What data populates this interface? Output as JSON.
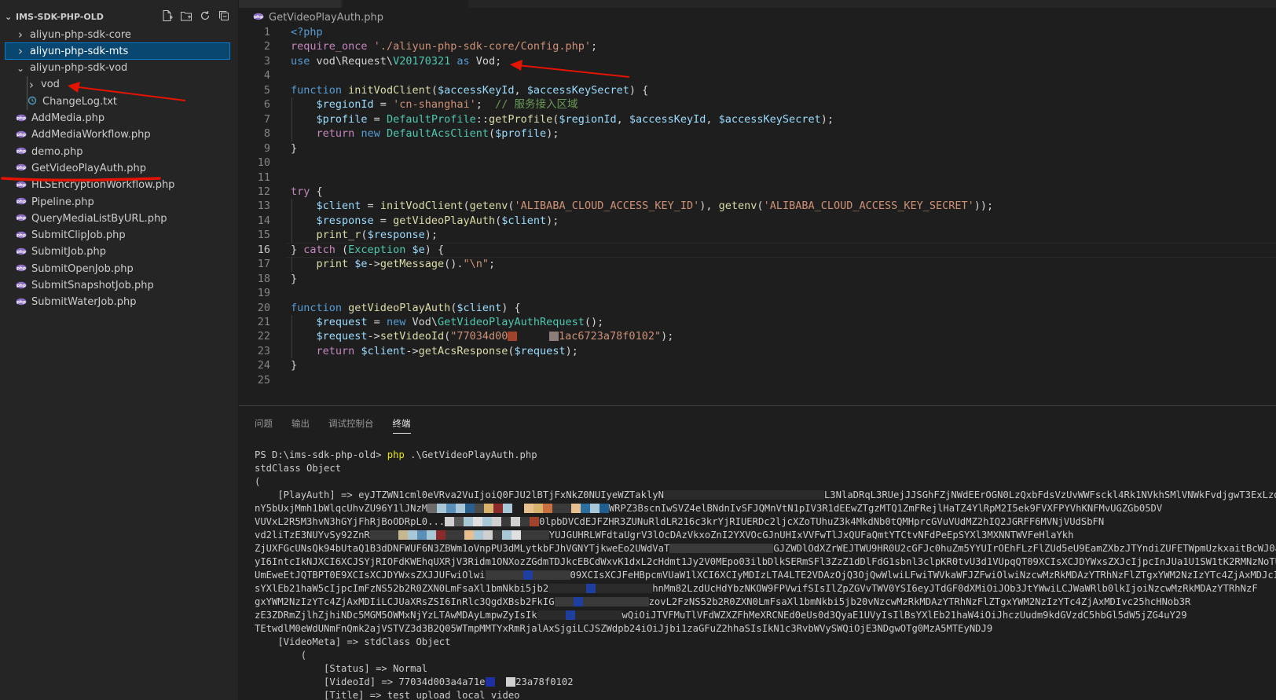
{
  "sidebar": {
    "title": "IMS-SDK-PHP-OLD",
    "actions": [
      "new-file-icon",
      "new-folder-icon",
      "refresh-icon",
      "collapse-icon"
    ],
    "items": [
      {
        "label": "aliyun-php-sdk-core",
        "kind": "folder",
        "expanded": false,
        "level": 1
      },
      {
        "label": "aliyun-php-sdk-mts",
        "kind": "folder",
        "expanded": false,
        "level": 1,
        "selected": true
      },
      {
        "label": "aliyun-php-sdk-vod",
        "kind": "folder",
        "expanded": true,
        "level": 1
      },
      {
        "label": "vod",
        "kind": "folder",
        "expanded": false,
        "level": 2
      },
      {
        "label": "ChangeLog.txt",
        "kind": "txt",
        "level": 2
      },
      {
        "label": "AddMedia.php",
        "kind": "php",
        "level": 1
      },
      {
        "label": "AddMediaWorkflow.php",
        "kind": "php",
        "level": 1
      },
      {
        "label": "demo.php",
        "kind": "php",
        "level": 1
      },
      {
        "label": "GetVideoPlayAuth.php",
        "kind": "php",
        "level": 1
      },
      {
        "label": "HLSEncryptionWorkflow.php",
        "kind": "php",
        "level": 1
      },
      {
        "label": "Pipeline.php",
        "kind": "php",
        "level": 1
      },
      {
        "label": "QueryMediaListByURL.php",
        "kind": "php",
        "level": 1
      },
      {
        "label": "SubmitClipJob.php",
        "kind": "php",
        "level": 1
      },
      {
        "label": "SubmitJob.php",
        "kind": "php",
        "level": 1
      },
      {
        "label": "SubmitOpenJob.php",
        "kind": "php",
        "level": 1
      },
      {
        "label": "SubmitSnapshotJob.php",
        "kind": "php",
        "level": 1
      },
      {
        "label": "SubmitWaterJob.php",
        "kind": "php",
        "level": 1
      }
    ]
  },
  "editor": {
    "breadcrumb": "GetVideoPlayAuth.php",
    "current_line": 16,
    "lines": [
      [
        [
          "k",
          "<?php"
        ]
      ],
      [
        [
          "c",
          "require_once"
        ],
        [
          "p",
          " "
        ],
        [
          "s",
          "'./aliyun-php-sdk-core/Config.php'"
        ],
        [
          "p",
          ";"
        ]
      ],
      [
        [
          "k",
          "use"
        ],
        [
          "p",
          " vod\\Request\\"
        ],
        [
          "t",
          "V20170321"
        ],
        [
          "p",
          " "
        ],
        [
          "k",
          "as"
        ],
        [
          "p",
          " Vod;"
        ]
      ],
      [],
      [
        [
          "k",
          "function"
        ],
        [
          "p",
          " "
        ],
        [
          "f",
          "initVodClient"
        ],
        [
          "p",
          "("
        ],
        [
          "v",
          "$accessKeyId"
        ],
        [
          "p",
          ", "
        ],
        [
          "v",
          "$accessKeySecret"
        ],
        [
          "p",
          ") {"
        ]
      ],
      [
        [
          "p",
          "    "
        ],
        [
          "v",
          "$regionId"
        ],
        [
          "p",
          " = "
        ],
        [
          "s",
          "'cn-shanghai'"
        ],
        [
          "p",
          ";  "
        ],
        [
          "cm",
          "// 服务接入区域"
        ]
      ],
      [
        [
          "p",
          "    "
        ],
        [
          "v",
          "$profile"
        ],
        [
          "p",
          " = "
        ],
        [
          "t",
          "DefaultProfile"
        ],
        [
          "p",
          "::"
        ],
        [
          "f",
          "getProfile"
        ],
        [
          "p",
          "("
        ],
        [
          "v",
          "$regionId"
        ],
        [
          "p",
          ", "
        ],
        [
          "v",
          "$accessKeyId"
        ],
        [
          "p",
          ", "
        ],
        [
          "v",
          "$accessKeySecret"
        ],
        [
          "p",
          ");"
        ]
      ],
      [
        [
          "p",
          "    "
        ],
        [
          "c",
          "return"
        ],
        [
          "p",
          " "
        ],
        [
          "k",
          "new"
        ],
        [
          "p",
          " "
        ],
        [
          "t",
          "DefaultAcsClient"
        ],
        [
          "p",
          "("
        ],
        [
          "v",
          "$profile"
        ],
        [
          "p",
          ");"
        ]
      ],
      [
        [
          "p",
          "}"
        ]
      ],
      [],
      [],
      [
        [
          "c",
          "try"
        ],
        [
          "p",
          " {"
        ]
      ],
      [
        [
          "p",
          "    "
        ],
        [
          "v",
          "$client"
        ],
        [
          "p",
          " = "
        ],
        [
          "f",
          "initVodClient"
        ],
        [
          "p",
          "("
        ],
        [
          "f",
          "getenv"
        ],
        [
          "p",
          "("
        ],
        [
          "s",
          "'ALIBABA_CLOUD_ACCESS_KEY_ID'"
        ],
        [
          "p",
          "), "
        ],
        [
          "f",
          "getenv"
        ],
        [
          "p",
          "("
        ],
        [
          "s",
          "'ALIBABA_CLOUD_ACCESS_KEY_SECRET'"
        ],
        [
          "p",
          "));"
        ]
      ],
      [
        [
          "p",
          "    "
        ],
        [
          "v",
          "$response"
        ],
        [
          "p",
          " = "
        ],
        [
          "f",
          "getVideoPlayAuth"
        ],
        [
          "p",
          "("
        ],
        [
          "v",
          "$client"
        ],
        [
          "p",
          ");"
        ]
      ],
      [
        [
          "p",
          "    "
        ],
        [
          "f",
          "print_r"
        ],
        [
          "p",
          "("
        ],
        [
          "v",
          "$response"
        ],
        [
          "p",
          ");"
        ]
      ],
      [
        [
          "p",
          "} "
        ],
        [
          "c",
          "catch"
        ],
        [
          "p",
          " ("
        ],
        [
          "t",
          "Exception"
        ],
        [
          "p",
          " "
        ],
        [
          "v",
          "$e"
        ],
        [
          "p",
          ") {"
        ]
      ],
      [
        [
          "p",
          "    "
        ],
        [
          "f",
          "print"
        ],
        [
          "p",
          " "
        ],
        [
          "v",
          "$e"
        ],
        [
          "p",
          "->"
        ],
        [
          "f",
          "getMessage"
        ],
        [
          "p",
          "()."
        ],
        [
          "s",
          "\"\\n\""
        ],
        [
          "p",
          ";"
        ]
      ],
      [
        [
          "p",
          "}"
        ]
      ],
      [],
      [
        [
          "k",
          "function"
        ],
        [
          "p",
          " "
        ],
        [
          "f",
          "getVideoPlayAuth"
        ],
        [
          "p",
          "("
        ],
        [
          "v",
          "$client"
        ],
        [
          "p",
          ") {"
        ]
      ],
      [
        [
          "p",
          "    "
        ],
        [
          "v",
          "$request"
        ],
        [
          "p",
          " = "
        ],
        [
          "k",
          "new"
        ],
        [
          "p",
          " Vod\\"
        ],
        [
          "t",
          "GetVideoPlayAuthRequest"
        ],
        [
          "p",
          "();"
        ]
      ],
      [
        [
          "p",
          "    "
        ],
        [
          "v",
          "$request"
        ],
        [
          "p",
          "->"
        ],
        [
          "f",
          "setVideoId"
        ],
        [
          "p",
          "("
        ],
        [
          "s",
          "\"77034d00"
        ],
        [
          "r",
          "#a0432c"
        ],
        [
          "s",
          "     "
        ],
        [
          "r",
          "#8b7d78"
        ],
        [
          "s",
          "1ac6723a78f0102\""
        ],
        [
          "p",
          ");"
        ]
      ],
      [
        [
          "p",
          "    "
        ],
        [
          "c",
          "return"
        ],
        [
          "p",
          " "
        ],
        [
          "v",
          "$client"
        ],
        [
          "p",
          "->"
        ],
        [
          "f",
          "getAcsResponse"
        ],
        [
          "p",
          "("
        ],
        [
          "v",
          "$request"
        ],
        [
          "p",
          ");"
        ]
      ],
      [
        [
          "p",
          "}"
        ]
      ],
      []
    ]
  },
  "panel": {
    "tabs": [
      "问题",
      "输出",
      "调试控制台",
      "终端"
    ],
    "active_tab": "终端",
    "terminal": [
      [
        [
          "p",
          "PS D:\\ims-sdk-php-old> "
        ],
        [
          "y",
          "php"
        ],
        [
          "p",
          " .\\GetVideoPlayAuth.php"
        ]
      ],
      [
        [
          "p",
          "stdClass Object"
        ]
      ],
      [
        [
          "p",
          "("
        ]
      ],
      [
        [
          "p",
          "    [PlayAuth] => eyJTZWN1cml0eVRva2VuIjoiQ0FJU2lBTjFxNkZ0NUIyeWZTaklyN"
        ],
        [
          "r",
          "#2a2a2a"
        ],
        [
          "r",
          "#2a2a2a"
        ],
        [
          "r",
          "#2a2a2a"
        ],
        [
          "r",
          "#2a2a2a"
        ],
        [
          "r",
          "#2a2a2a"
        ],
        [
          "r",
          "#2a2a2a"
        ],
        [
          "r",
          "#2a2a2a"
        ],
        [
          "r",
          "#2a2a2a"
        ],
        [
          "r",
          "#2a2a2a"
        ],
        [
          "r",
          "#2a2a2a"
        ],
        [
          "r",
          "#2a2a2a"
        ],
        [
          "r",
          "#2a2a2a"
        ],
        [
          "r",
          "#2a2a2a"
        ],
        [
          "r",
          "#2a2a2a"
        ],
        [
          "r",
          "#2a2a2a"
        ],
        [
          "r",
          "#2a2a2a"
        ],
        [
          "r",
          "#2a2a2a"
        ],
        [
          "p",
          "L3NlaDRqL3RUejJJSGhFZjNWdEErOGN0LzQxbFdsVzUvWWFsckl4Rk1NVkhSMlVNWkFvdjgwT3ExLzdKb0hiOXpEWUF"
        ]
      ],
      [
        [
          "p",
          "nY5bUxjMmh1bWlqcUhvZU96Y1lJNzM"
        ],
        [
          "r",
          "#6b6b6b"
        ],
        [
          "r",
          "#a8c8d8"
        ],
        [
          "r",
          "#5a8fb8"
        ],
        [
          "r",
          "#a8c8d8"
        ],
        [
          "r",
          "#2a5f8f"
        ],
        [
          "r",
          "#4b4b4b"
        ],
        [
          "r",
          "#d9b26b"
        ],
        [
          "r",
          "#8b2a2a"
        ],
        [
          "r",
          "#a8c8d8"
        ],
        [
          "p",
          "  "
        ],
        [
          "r",
          "#e8c090"
        ],
        [
          "r",
          "#d9b26b"
        ],
        [
          "r",
          "#c87040"
        ],
        [
          "r",
          "#3a3a3a"
        ],
        [
          "r",
          "#3a3a3a"
        ],
        [
          "r",
          "#e8c090"
        ],
        [
          "r",
          "#2a6f9f"
        ],
        [
          "r",
          "#a8c8d8"
        ],
        [
          "r",
          "#1f5f8f"
        ],
        [
          "p",
          "WRPZ3BscnIwSVZ4elBNdnIvSFJQMnVtN1pIV3R1dEEwZTgzMTQ1ZmFRejlHaTZ4YlRpM2I5ek9FVXFPYVhKNFMvUGZGb05DV"
        ]
      ],
      [
        [
          "p",
          "VUVxL2R5M3hvN3hGYjFhRjBoODRpL0..."
        ],
        [
          "r",
          "#d0d0d0"
        ],
        [
          "r",
          "#5a5a5a"
        ],
        [
          "r",
          "#a8c8d8"
        ],
        [
          "r",
          "#e0e0e0"
        ],
        [
          "r",
          "#a8c8d8"
        ],
        [
          "r",
          "#d0d0d0"
        ],
        [
          "r",
          "#3a3a3a"
        ],
        [
          "r",
          "#d0d0d0"
        ],
        [
          "r",
          "#3a3a3a"
        ],
        [
          "r",
          "#a0432c"
        ],
        [
          "p",
          "0lpbDVCdEJFZHR3ZUNuRldLR216c3krYjRIUERDc2ljcXZoTUhuZ3k4MkdNb0tQMHprcGVuVUdMZ2hIQ2JGRFF6MVNjVUdSbFN"
        ]
      ],
      [
        [
          "p",
          "vd2liTzE3NUYvSy92ZnR"
        ],
        [
          "r",
          "#3a3a3a"
        ],
        [
          "r",
          "#3a3a3a"
        ],
        [
          "r",
          "#3a3a3a"
        ],
        [
          "r",
          "#c8b890"
        ],
        [
          "r",
          "#a8c8d8"
        ],
        [
          "r",
          "#5a8fb8"
        ],
        [
          "r",
          "#a8c8d8"
        ],
        [
          "r",
          "#8b2a2a"
        ],
        [
          "r",
          "#3a3a3a"
        ],
        [
          "r",
          "#3a3a3a"
        ],
        [
          "r",
          "#e8c090"
        ],
        [
          "r",
          "#a8c8d8"
        ],
        [
          "r",
          "#d0d0d0"
        ],
        [
          "r",
          "#3a3a3a"
        ],
        [
          "r",
          "#a8c8d8"
        ],
        [
          "r",
          "#e0e0e0"
        ],
        [
          "r",
          "#3a3a3a"
        ],
        [
          "r",
          "#3a3a3a"
        ],
        [
          "r",
          "#3a3a3a"
        ],
        [
          "p",
          "YUJGUHRLWFdtaUgrV3lOcDAzVkxoZnI2YXVOcGJnUHIxVVFwTlJxQUFaQmtYTCtvNFdPeEpSYXl3MXNNTWVFeHlaYkh"
        ]
      ],
      [
        [
          "p",
          "ZjUXFGcUNsQk94bUtaQ1B3dDNFWUF6N3ZBWm1oVnpPU3dMLytkbFJhVGNYTjkweEo2UWdVaT"
        ],
        [
          "r",
          "#3a3a3a"
        ],
        [
          "r",
          "#3a3a3a"
        ],
        [
          "r",
          "#3a3a3a"
        ],
        [
          "r",
          "#3a3a3a"
        ],
        [
          "r",
          "#3a3a3a"
        ],
        [
          "r",
          "#3a3a3a"
        ],
        [
          "r",
          "#3a3a3a"
        ],
        [
          "r",
          "#3a3a3a"
        ],
        [
          "r",
          "#3a3a3a"
        ],
        [
          "r",
          "#3a3a3a"
        ],
        [
          "r",
          "#3a3a3a"
        ],
        [
          "p",
          "GJZWDlOdXZrWEJTWU9HR0U2cGFJc0huZm5YYUIrOEhFLzFlZUd5eU9EamZXbzJTYndiZUFETWpmUzkxaitBcWJ0a3g"
        ]
      ],
      [
        [
          "p",
          "yI6IntcIkNJXCI6XCJSYjRIOFdKWEhqUXRjV3Ridm1ONXozZGdmTDJkcEBCdWxvK1dxL2cHdmt1Jy2V0MEpo03ilbDlkSERmSFl3ZzZ1dDlFdG1sbnl3clpKR0tvU3d1VUpqQT09XCIsXCJDYWxsZXJcIjpcInJUa1U1SW1tK2RMNzNoTUtYMmg0TTFWTVB"
        ]
      ],
      [
        [
          "p",
          "UmEweEtJQTBPT0E9XCIsXCJDYWxsZXJJUFwiOlwi"
        ],
        [
          "r",
          "#3a3a3a"
        ],
        [
          "r",
          "#3a3a3a"
        ],
        [
          "r",
          "#3a3a3a"
        ],
        [
          "r",
          "#3a3a3a"
        ],
        [
          "r",
          "#1f3f9f"
        ],
        [
          "r",
          "#3a3a3a"
        ],
        [
          "r",
          "#3a3a3a"
        ],
        [
          "r",
          "#3a3a3a"
        ],
        [
          "r",
          "#3a3a3a"
        ],
        [
          "p",
          "09XCIsXCJFeHBpcmVUaW1lXCI6XCIyMDIzLTA4LTE2VDAzOjQ3OjQwWlwiLFwiTWVkaWFJZFwiOlwiNzcwMzRkMDAzYTRhNzFlZTgxYWM2NzIzYTc4ZjAxMDJcIixcIlBsYXl"
        ]
      ],
      [
        [
          "p",
          "sYXlEb21haW5cIjpcImFzNS52b2R0ZXN0LmFsaXl1bmNkbi5jb2"
        ],
        [
          "r",
          "#2a2a2a"
        ],
        [
          "r",
          "#2a2a2a"
        ],
        [
          "r",
          "#2a2a2a"
        ],
        [
          "r",
          "#2a2a2a"
        ],
        [
          "r",
          "#1f3f9f"
        ],
        [
          "r",
          "#2a2a2a"
        ],
        [
          "r",
          "#2a2a2a"
        ],
        [
          "r",
          "#2a2a2a"
        ],
        [
          "r",
          "#2a2a2a"
        ],
        [
          "r",
          "#2a2a2a"
        ],
        [
          "r",
          "#2a2a2a"
        ],
        [
          "p",
          "hnMm82LzdUcHdYbzNKOW9FPVwifSIsIlZpZGVvTWV0YSI6eyJTdGF0dXMiOiJOb3JtYWwiLCJWaWRlb0lkIjoiNzcwMzRkMDAzYTRhNzF"
        ]
      ],
      [
        [
          "p",
          "gxYWM2NzIzYTc4ZjAxMDIiLCJUaXRsZSI6InRlc3QgdXBsb2FkIG"
        ],
        [
          "r",
          "#3a3a3a"
        ],
        [
          "r",
          "#3a3a3a"
        ],
        [
          "r",
          "#1f3f9f"
        ],
        [
          "r",
          "#3a3a3a"
        ],
        [
          "r",
          "#3a3a3a"
        ],
        [
          "r",
          "#3a3a3a"
        ],
        [
          "r",
          "#3a3a3a"
        ],
        [
          "r",
          "#3a3a3a"
        ],
        [
          "r",
          "#3a3a3a"
        ],
        [
          "r",
          "#3a3a3a"
        ],
        [
          "p",
          "zovL2FzNS52b2R0ZXN0LmFsaXl1bmNkbi5jb20vNzcwMzRkMDAzYTRhNzFlZTgxYWM2NzIzYTc4ZjAxMDIvc25hcHNob3R"
        ]
      ],
      [
        [
          "p",
          "zE3ZDRmZjlhZjhiNDc5MGM5OWMxNjYzLTAwMDAyLmpwZyIsIk"
        ],
        [
          "r",
          "#2a2a2a"
        ],
        [
          "r",
          "#2a2a2a"
        ],
        [
          "r",
          "#2a2a2a"
        ],
        [
          "r",
          "#1f3f9f"
        ],
        [
          "r",
          "#2a2a2a"
        ],
        [
          "r",
          "#2a2a2a"
        ],
        [
          "r",
          "#2a2a2a"
        ],
        [
          "r",
          "#2a2a2a"
        ],
        [
          "r",
          "#2a2a2a"
        ],
        [
          "p",
          "wQiOiJTVFMuTlVFdWZXZFhMeXRCNEd0eUs0d3QyaE1UVyIsIlBsYXlEb21haW4iOiJhczUudm9kdGVzdC5hbGl5dW5jZG4uY29"
        ]
      ],
      [
        [
          "p",
          "TEtwdlM0eWdUNmFnQmk2ajVSTVZ3d3B2Q05WTmpMMTYxRmRjalAxSjgiLCJSZWdpb24iOiJjbi1zaGFuZ2hhaSIsIkN1c3RvbWVySWQiOjE3NDgwOTg0MzA5MTEyNDJ9"
        ]
      ],
      [
        [
          "p",
          "    [VideoMeta] => stdClass Object"
        ]
      ],
      [
        [
          "p",
          "        ("
        ]
      ],
      [
        [
          "p",
          "            [Status] => Normal"
        ]
      ],
      [
        [
          "p",
          "            [VideoId] => 77034d003a4a71e"
        ],
        [
          "r",
          "#1f2f9f"
        ],
        [
          "p",
          "  "
        ],
        [
          "r",
          "#d0d0d0"
        ],
        [
          "p",
          "23a78f0102"
        ]
      ],
      [
        [
          "p",
          "            [Title] => test upload local video"
        ]
      ]
    ]
  },
  "annotations": {
    "arrow_color": "#e51400",
    "underline_color": "#e51400"
  }
}
